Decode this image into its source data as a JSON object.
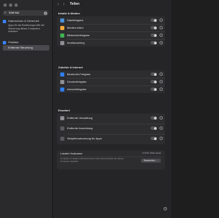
{
  "sidebar": {
    "search": {
      "value": "intersat",
      "icon": "search-icon"
    },
    "items": [
      {
        "label": "Datenschutz & Sicherheit",
        "icon_color": "#3a82f7"
      },
      {
        "label": "Displays",
        "icon_color": "#3a82f7"
      }
    ],
    "description": "Apps für die Bedienungs-hilfe die Steuerung dieses Computers erlauben",
    "selected": "Entfernte Steuerung"
  },
  "header": {
    "title": "Teilen",
    "back": "‹",
    "forward": "›"
  },
  "sections": [
    {
      "title": "Inhalte & Medien",
      "rows": [
        {
          "label": "Dateifreigabe",
          "icon_color": "#4a90d9"
        },
        {
          "label": "Medien teilen",
          "icon_color": "#f2a93b"
        },
        {
          "label": "Bildschirmfreigabe",
          "icon_color": "#3fb24f"
        },
        {
          "label": "Inhaltscaching",
          "icon_color": "#8e8e93"
        }
      ]
    },
    {
      "title": "Zubehör & Internet",
      "rows": [
        {
          "label": "Bluetooth-Freigabe",
          "icon_color": "#2f7ff0"
        },
        {
          "label": "Druckerfreigabe",
          "icon_color": "#8e8e93"
        },
        {
          "label": "Internetfreigabe",
          "icon_color": "#2f7ff0"
        }
      ]
    },
    {
      "title": "Erweitert",
      "rows": [
        {
          "label": "Entfernte Verwaltung",
          "icon_color": "#8e8e93"
        },
        {
          "label": "Entfernte Anmeldung",
          "icon_color": "#5a5a5e"
        },
        {
          "label": "Skriptfernsteuerung für Apps",
          "icon_color": "#5a5a5e"
        }
      ]
    }
  ],
  "host": {
    "label": "Lokaler Hostname",
    "value": "8 Krits iMac.local",
    "description": "Computer im lokalen Netzwerk können über diese Adresse auf deinen Computer zugreifen.",
    "button": "Bearbeiten …"
  },
  "footer": {
    "help": "?"
  },
  "colors": {
    "accent": "#3a82f7",
    "background": "#252527"
  }
}
